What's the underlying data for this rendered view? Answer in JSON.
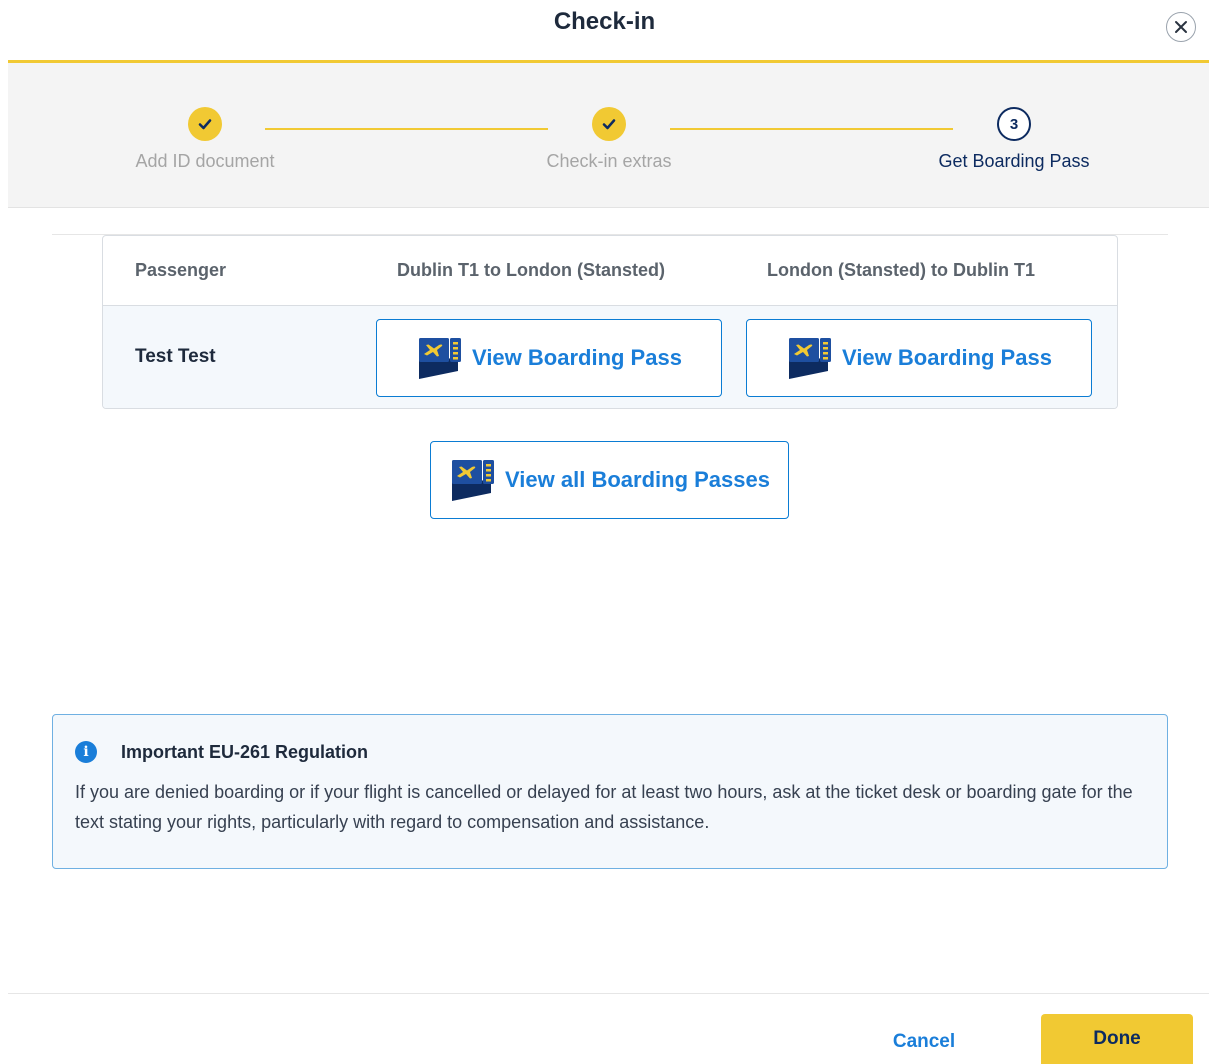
{
  "dialog": {
    "title": "Check-in",
    "close_icon": "close-icon"
  },
  "stepper": {
    "steps": [
      {
        "label": "Add ID document",
        "status": "done",
        "icon": "check-icon"
      },
      {
        "label": "Check-in extras",
        "status": "done",
        "icon": "check-icon"
      },
      {
        "label": "Get Boarding Pass",
        "status": "current",
        "number": "3"
      }
    ]
  },
  "table": {
    "columns": [
      "Passenger",
      "Dublin T1 to London (Stansted)",
      "London (Stansted) to Dublin T1"
    ],
    "rows": [
      {
        "passenger": "Test Test",
        "outbound_button": "View Boarding Pass",
        "return_button": "View Boarding Pass"
      }
    ]
  },
  "view_all_button": "View all Boarding Passes",
  "notice": {
    "icon": "info-icon",
    "title": "Important EU-261 Regulation",
    "text": "If you are denied boarding or if your flight is cancelled or delayed for at least two hours, ask at the ticket desk or boarding gate for the text stating your rights, particularly with regard to compensation and assistance."
  },
  "footer": {
    "cancel_label": "Cancel",
    "done_label": "Done"
  },
  "colors": {
    "accent_yellow": "#f1c933",
    "link_blue": "#1a7ed9",
    "navy": "#0d2b60"
  }
}
